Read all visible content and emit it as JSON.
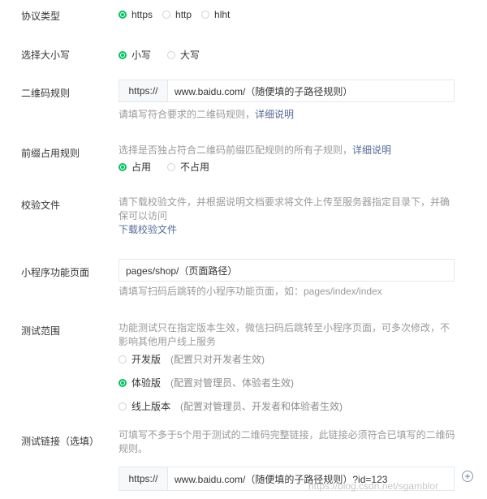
{
  "protocol": {
    "label": "协议类型",
    "options": [
      "https",
      "http",
      "hlht"
    ],
    "selected_index": 0
  },
  "case": {
    "label": "选择大小写",
    "options": [
      "小写",
      "大写"
    ],
    "selected_index": 0
  },
  "qr_rule": {
    "label": "二维码规则",
    "prefix": "https://",
    "value": "www.baidu.com/（随便填的子路径规则）",
    "hint": "请填写符合要求的二维码规则，",
    "hint_link": "详细说明"
  },
  "prefix_rule": {
    "label": "前缀占用规则",
    "hint": "选择是否独占符合二维码前缀匹配规则的所有子规则，",
    "hint_link": "详细说明",
    "options": [
      "占用",
      "不占用"
    ],
    "selected_index": 0
  },
  "verify_file": {
    "label": "校验文件",
    "hint_line1": "请下载校验文件，并根据说明文档要求将文件上传至服务器指定目录下，并确",
    "hint_line2": "保可以访问",
    "download_link": "下载校验文件"
  },
  "miniprogram_page": {
    "label": "小程序功能页面",
    "value": "pages/shop/（页面路径）",
    "hint": "请填写扫码后跳转的小程序功能页面，如：pages/index/index"
  },
  "test_scope": {
    "label": "测试范围",
    "hint_line1": "功能测试只在指定版本生效，微信扫码后跳转至小程序页面，可多次修改，不",
    "hint_line2": "影响其他用户线上服务",
    "options": [
      {
        "name": "开发版",
        "desc": "(配置只对开发者生效)"
      },
      {
        "name": "体验版",
        "desc": "(配置对管理员、体验者生效)"
      },
      {
        "name": "线上版本",
        "desc": "(配置对管理员、开发者和体验者生效)"
      }
    ],
    "selected_index": 1
  },
  "test_link": {
    "label": "测试链接（选填）",
    "hint_line1": "可填写不多于5个用于测试的二维码完整链接，此链接必须符合已填写的二维码",
    "hint_line2": "规则。",
    "prefix": "https://",
    "value": "www.baidu.com/（随便填的子路径规则）?id=123",
    "add_icon": "plus-circle-icon"
  },
  "watermark": "https://blog.csdn.net/sgamblor",
  "colors": {
    "accent": "#07c160",
    "link": "#576b95",
    "hint": "#9a9a9a"
  }
}
